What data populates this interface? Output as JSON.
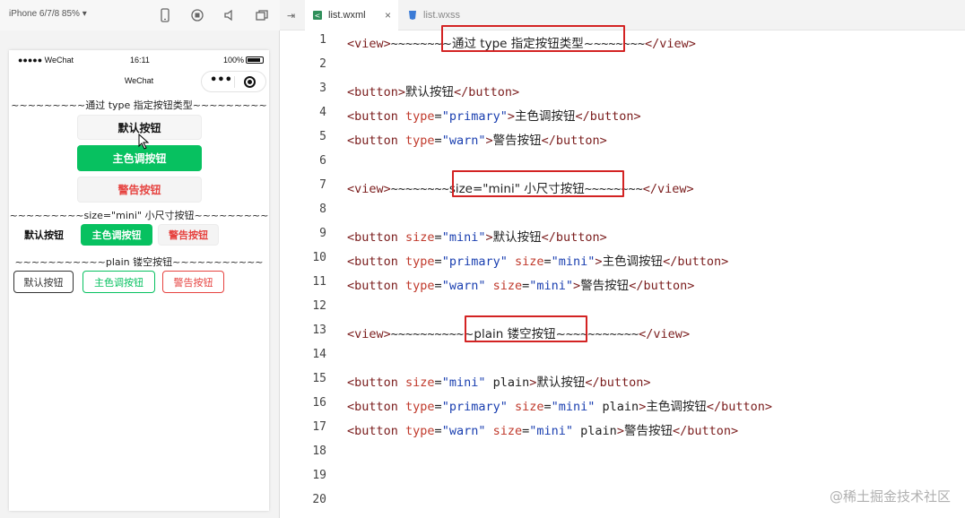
{
  "simulator": {
    "device_label": "iPhone 6/7/8 85% ▾",
    "status": {
      "carrier": "●●●●● WeChat",
      "time": "16:11",
      "battery": "100%"
    },
    "nav_title": "WeChat",
    "capsule": {
      "dots": "•••"
    },
    "lines": {
      "type_heading": "~~~~~~~~~通过 type 指定按钮类型~~~~~~~~~",
      "size_heading": "~~~~~~~~~size=\"mini\" 小尺寸按钮~~~~~~~~~",
      "plain_heading": "~~~~~~~~~~~plain 镂空按钮~~~~~~~~~~~"
    },
    "buttons": {
      "default": "默认按钮",
      "primary": "主色调按钮",
      "warn": "警告按钮"
    },
    "colors": {
      "primary": "#07c160",
      "warn": "#e64340"
    }
  },
  "editor": {
    "tabs": [
      {
        "label": "list.wxml",
        "active": true,
        "close": "×"
      },
      {
        "label": "list.wxss",
        "active": false
      }
    ],
    "lines": {
      "n1": "1",
      "n2": "2",
      "n3": "3",
      "n4": "4",
      "n5": "5",
      "n6": "6",
      "n7": "7",
      "n8": "8",
      "n9": "9",
      "n10": "10",
      "n11": "11",
      "n12": "12",
      "n13": "13",
      "n14": "14",
      "n15": "15",
      "n16": "16",
      "n17": "17",
      "n18": "18",
      "n19": "19",
      "n20": "20"
    },
    "code": {
      "l1": {
        "open": "<view>",
        "pre": "~~~~~~~",
        "mid": "~通过 type 指定按钮类型~",
        "post": "~~~~~~~",
        "close": "</view>"
      },
      "l3": {
        "open": "<button>",
        "text": "默认按钮",
        "close": "</button>"
      },
      "l4": {
        "open": "<button ",
        "attr1": "type",
        "eq": "=",
        "val1": "\"primary\"",
        "gt": ">",
        "text": "主色调按钮",
        "close": "</button>"
      },
      "l5": {
        "open": "<button ",
        "attr1": "type",
        "eq": "=",
        "val1": "\"warn\"",
        "gt": ">",
        "text": "警告按钮",
        "close": "</button>"
      },
      "l7": {
        "open": "<view>",
        "pre": "~~~~~~~~",
        "mid": "size=\"mini\" 小尺寸按钮",
        "post": "~~~~~~~~",
        "close": "</view>"
      },
      "l9": {
        "open": "<button ",
        "attr1": "size",
        "eq": "=",
        "val1": "\"mini\"",
        "gt": ">",
        "text": "默认按钮",
        "close": "</button>"
      },
      "l10": {
        "open": "<button ",
        "attr1": "type",
        "val1": "\"primary\"",
        "attr2": "size",
        "val2": "\"mini\"",
        "eq": "=",
        "gt": ">",
        "text": "主色调按钮",
        "close": "</button>"
      },
      "l11": {
        "open": "<button ",
        "attr1": "type",
        "val1": "\"warn\"",
        "attr2": "size",
        "val2": "\"mini\"",
        "eq": "=",
        "gt": ">",
        "text": "警告按钮",
        "close": "</button>"
      },
      "l13": {
        "open": "<view>",
        "pre": "~~~~~~~~~~",
        "mid": "~plain 镂空按钮~",
        "post": "~~~~~~~~~~",
        "close": "</view>"
      },
      "l15": {
        "open": "<button ",
        "attr1": "size",
        "eq": "=",
        "val1": "\"mini\"",
        "plain": " plain",
        "gt": ">",
        "text": "默认按钮",
        "close": "</button>"
      },
      "l16": {
        "open": "<button ",
        "attr1": "type",
        "val1": "\"primary\"",
        "attr2": "size",
        "val2": "\"mini\"",
        "eq": "=",
        "plain": " plain",
        "gt": ">",
        "text": "主色调按钮",
        "close": "</button>"
      },
      "l17": {
        "open": "<button ",
        "attr1": "type",
        "val1": "\"warn\"",
        "attr2": "size",
        "val2": "\"mini\"",
        "eq": "=",
        "plain": " plain",
        "gt": ">",
        "text": "警告按钮",
        "close": "</button>"
      }
    }
  },
  "watermark": "@稀土掘金技术社区"
}
